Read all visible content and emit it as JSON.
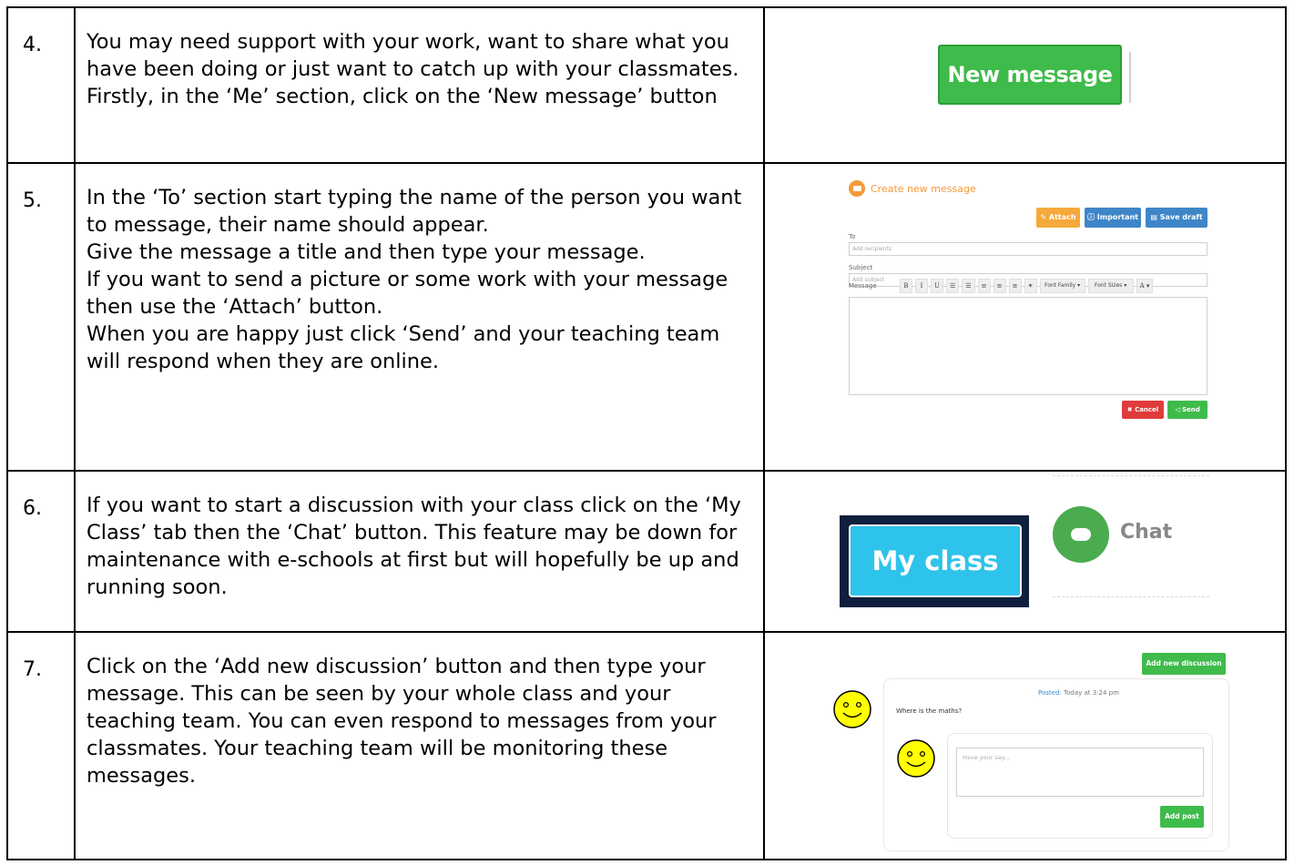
{
  "rows": [
    {
      "number": "4.",
      "lines": [
        "You may need support with your work, want to share what you have been doing or just want to catch up with your classmates.",
        "Firstly, in the ‘Me’ section, click on the ‘New message’ button"
      ]
    },
    {
      "number": "5.",
      "lines": [
        "In the ‘To’ section start typing the name of the person you want to message, their name should appear.",
        "Give the message a title and then type your message.",
        "If you want to send a picture or some work with your message then use the ‘Attach’ button.",
        "When you are happy just click ‘Send’ and your teaching team will respond when they are online."
      ]
    },
    {
      "number": "6.",
      "lines": [
        "If you want to start a discussion with your class click on the ‘My Class’ tab then the ‘Chat’ button. This feature may be down for maintenance with e-schools at first but will hopefully be up and running soon."
      ]
    },
    {
      "number": "7.",
      "lines": [
        "Click on the ‘Add new discussion’ button and then type your message. This can be seen by your whole class and your teaching team. You can even respond to messages from your classmates. Your teaching team will be monitoring these messages."
      ]
    }
  ],
  "new_message_button": "New message",
  "compose": {
    "title": "Create new message",
    "attach": "✎ Attach",
    "important": "ⓘ Important",
    "save_draft": "▤ Save draft",
    "to_label": "To",
    "to_placeholder": "Add recipients",
    "subject_label": "Subject",
    "subject_placeholder": "Add subject",
    "message_label": "Message",
    "toolbar": [
      "B",
      "I",
      "U",
      "☰",
      "☰",
      "≡",
      "≡",
      "≡",
      "✶"
    ],
    "font_family": "Font Family ▾",
    "font_sizes": "Font Sizes ▾",
    "font_color": "A ▾",
    "cancel": "✖ Cancel",
    "send": "◁ Send"
  },
  "my_class_button": "My class",
  "chat_label": "Chat",
  "discussion": {
    "add_new": "Add new discussion",
    "posted_label": "Posted:",
    "posted_time": "Today at 3:24 pm",
    "question": "Where is the maths?",
    "reply_placeholder": "Have your say...",
    "add_post": "Add post"
  },
  "colors": {
    "green": "#3fbb4b",
    "orange": "#f39a3a",
    "blue": "#3f86c8",
    "red": "#e03b3b",
    "cyan": "#2ec3ea",
    "navy": "#0f1f3d",
    "smiley": "#ffff00"
  }
}
